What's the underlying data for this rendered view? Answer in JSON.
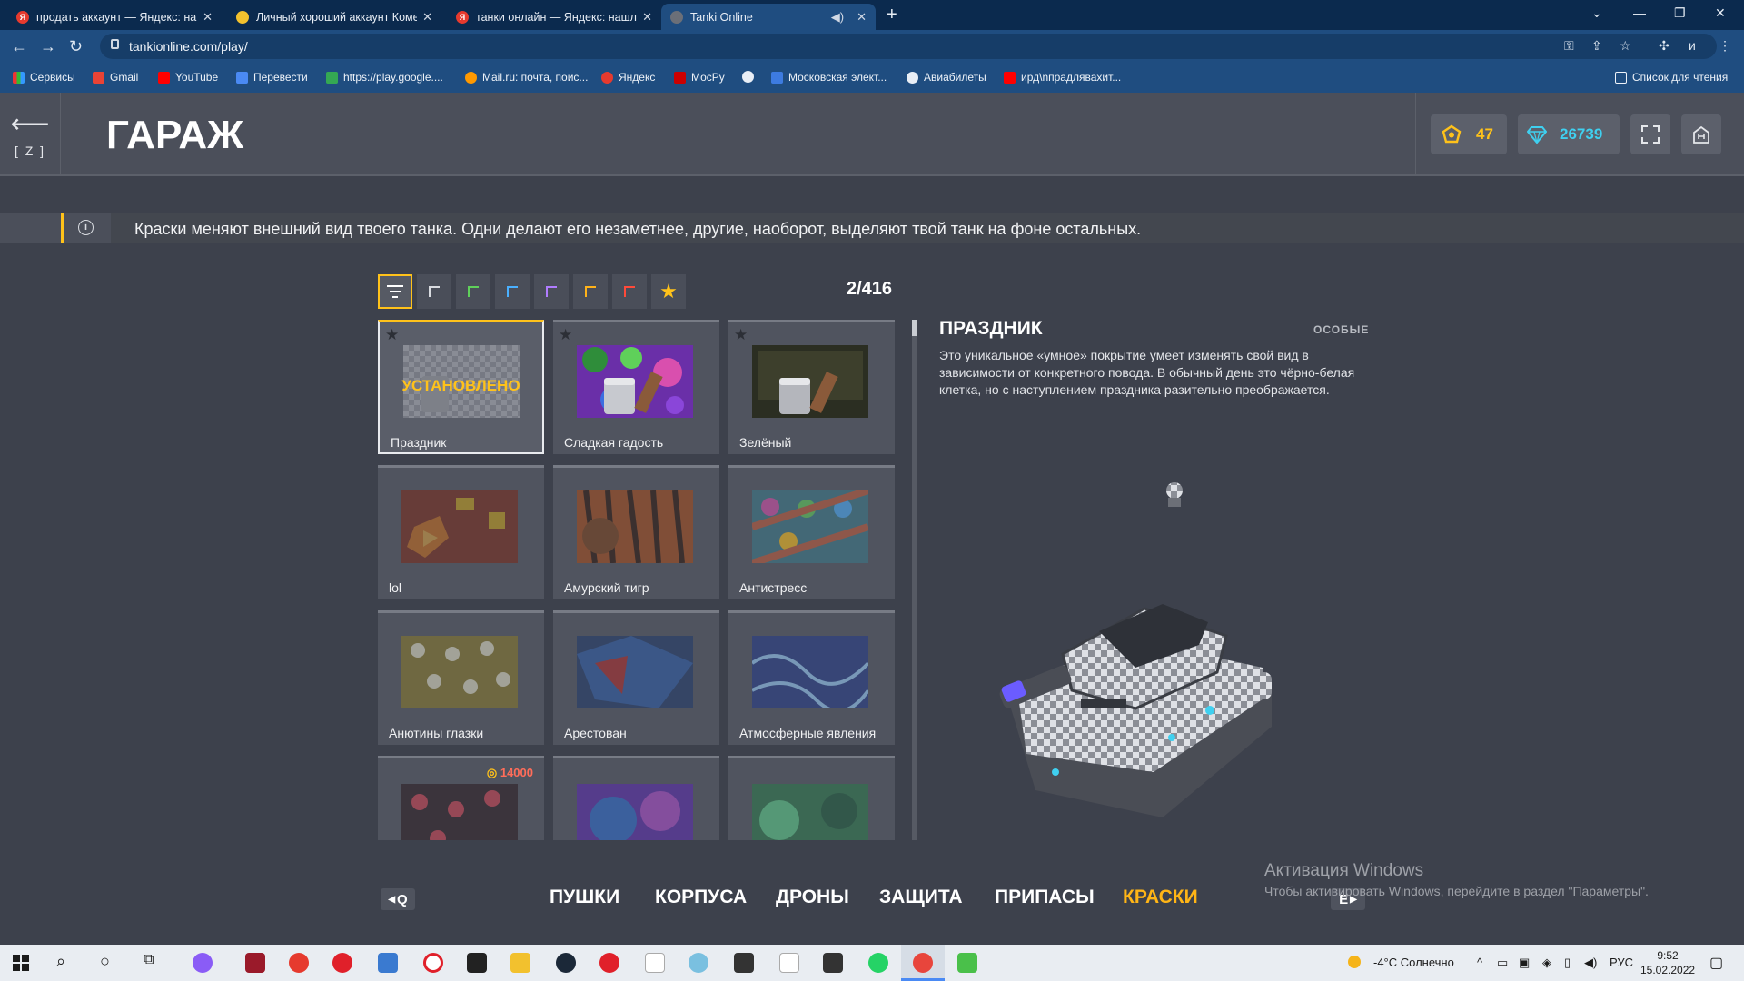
{
  "browser": {
    "tabs": [
      {
        "title": "продать аккаунт — Яндекс: наш",
        "icon": "yandex-icon"
      },
      {
        "title": "Личный хороший аккаунт Коме",
        "icon": "coin-icon"
      },
      {
        "title": "танки онлайн — Яндекс: нашло",
        "icon": "yandex-icon"
      },
      {
        "title": "Tanki Online",
        "icon": "tanki-icon"
      }
    ],
    "url": "tankionline.com/play/",
    "profile_letter": "и",
    "bookmarks": [
      {
        "label": "Сервисы",
        "icon": "apps-icon"
      },
      {
        "label": "Gmail",
        "icon": "gmail-icon"
      },
      {
        "label": "YouTube",
        "icon": "youtube-icon"
      },
      {
        "label": "Перевести",
        "icon": "translate-icon"
      },
      {
        "label": "https://play.google....",
        "icon": "play-icon"
      },
      {
        "label": "Mail.ru: почта, поис...",
        "icon": "mailru-icon"
      },
      {
        "label": "Яндекс",
        "icon": "yandex-icon"
      },
      {
        "label": "МосРу",
        "icon": "mosru-icon"
      },
      {
        "label": "",
        "icon": "globe-icon"
      },
      {
        "label": "Московская элект...",
        "icon": "mesh-icon"
      },
      {
        "label": "Авиабилеты",
        "icon": "globe-icon"
      },
      {
        "label": "ирд\\nпрадляваxит...",
        "icon": "youtube-icon"
      }
    ],
    "reading_list": "Список для чтения"
  },
  "game": {
    "title": "ГАРАЖ",
    "back_key": "[ Z ]",
    "crystals_small": "47",
    "crystals": "26739",
    "info_text": "Краски меняют внешний вид твоего танка. Одни делают его незаметнее, другие, наоборот, выделяют твой танк на фоне остальных.",
    "counter": "2/416",
    "filter_colors": [
      "#d9dbe0",
      "#5fd05a",
      "#4ab0ff",
      "#b07cff",
      "#ffb21a",
      "#ff4a3a"
    ],
    "items": [
      {
        "name": "Праздник",
        "status": "УСТАНОВЛЕНО",
        "selected": true
      },
      {
        "name": "Сладкая гадость"
      },
      {
        "name": "Зелёный"
      },
      {
        "name": "lol"
      },
      {
        "name": "Амурский тигр"
      },
      {
        "name": "Антистресс"
      },
      {
        "name": "Анютины глазки"
      },
      {
        "name": "Арестован"
      },
      {
        "name": "Атмосферные явления"
      },
      {
        "name": "",
        "price": "14000"
      },
      {
        "name": ""
      },
      {
        "name": ""
      }
    ],
    "detail": {
      "title": "ПРАЗДНИК",
      "category": "ОСОБЫЕ",
      "description": "Это уникальное «умное» покрытие умеет изменять свой вид в зависимости от конкретного повода. В обычный день это чёрно-белая клетка, но с наступлением праздника разительно преображается."
    },
    "nav": {
      "q_key": "Q",
      "e_key": "E",
      "tabs": [
        "ПУШКИ",
        "КОРПУСА",
        "ДРОНЫ",
        "ЗАЩИТА",
        "ПРИПАСЫ",
        "КРАСКИ"
      ],
      "active": "КРАСКИ"
    },
    "win_activation": {
      "title": "Активация Windows",
      "text": "Чтобы активировать Windows, перейдите в раздел \"Параметры\"."
    }
  },
  "taskbar": {
    "weather": "-4°C  Солнечно",
    "lang": "РУС",
    "time": "9:52",
    "date": "15.02.2022"
  },
  "colors": {
    "accent": "#ffc21a",
    "active_tab": "#ffb516",
    "price": "#ff6d5a",
    "diamond": "#3fd0f0"
  }
}
